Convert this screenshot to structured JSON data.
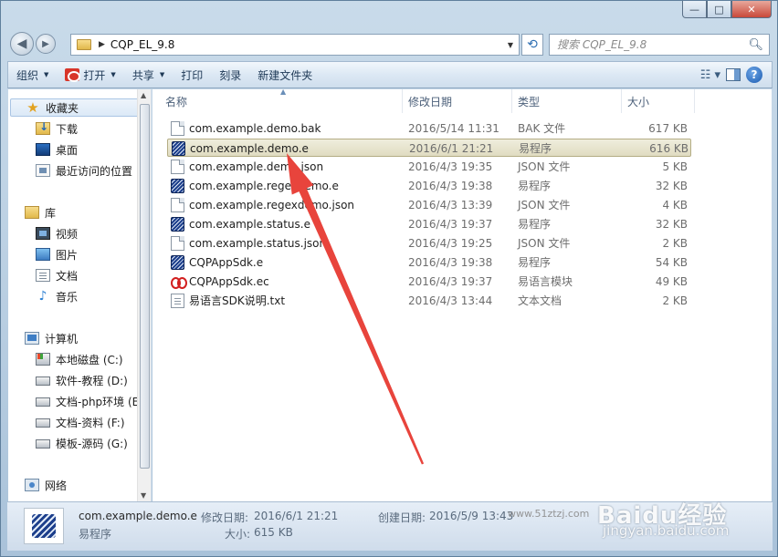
{
  "window": {
    "caption_buttons": {
      "minimize": "—",
      "maximize": "□",
      "close": "✕"
    }
  },
  "address_bar": {
    "path": "CQP_EL_9.8",
    "search_placeholder": "搜索 CQP_EL_9.8"
  },
  "toolbar": {
    "organize": "组织",
    "open": "打开",
    "share": "共享",
    "print": "打印",
    "burn": "刻录",
    "new_folder": "新建文件夹"
  },
  "nav_pane": {
    "favorites": "收藏夹",
    "downloads": "下载",
    "desktop": "桌面",
    "recent": "最近访问的位置",
    "libraries": "库",
    "videos": "视频",
    "pictures": "图片",
    "documents": "文档",
    "music": "音乐",
    "computer": "计算机",
    "drives": [
      "本地磁盘 (C:)",
      "软件-教程 (D:)",
      "文档-php环境 (E",
      "文档-资料 (F:)",
      "模板-源码 (G:)"
    ],
    "network": "网络"
  },
  "columns": {
    "name": "名称",
    "date": "修改日期",
    "type": "类型",
    "size": "大小"
  },
  "files": [
    {
      "name": "com.example.demo.bak",
      "date": "2016/5/14 11:31",
      "type": "BAK 文件",
      "size": "617 KB",
      "icon": "generic-file-icon"
    },
    {
      "name": "com.example.demo.e",
      "date": "2016/6/1 21:21",
      "type": "易程序",
      "size": "616 KB",
      "icon": "e-program-icon"
    },
    {
      "name": "com.example.demo.json",
      "date": "2016/4/3 19:35",
      "type": "JSON 文件",
      "size": "5 KB",
      "icon": "generic-file-icon"
    },
    {
      "name": "com.example.regexdemo.e",
      "date": "2016/4/3 19:38",
      "type": "易程序",
      "size": "32 KB",
      "icon": "e-program-icon"
    },
    {
      "name": "com.example.regexdemo.json",
      "date": "2016/4/3 13:39",
      "type": "JSON 文件",
      "size": "4 KB",
      "icon": "generic-file-icon"
    },
    {
      "name": "com.example.status.e",
      "date": "2016/4/3 19:37",
      "type": "易程序",
      "size": "32 KB",
      "icon": "e-program-icon"
    },
    {
      "name": "com.example.status.json",
      "date": "2016/4/3 19:25",
      "type": "JSON 文件",
      "size": "2 KB",
      "icon": "generic-file-icon"
    },
    {
      "name": "CQPAppSdk.e",
      "date": "2016/4/3 19:38",
      "type": "易程序",
      "size": "54 KB",
      "icon": "e-program-icon"
    },
    {
      "name": "CQPAppSdk.ec",
      "date": "2016/4/3 19:37",
      "type": "易语言模块",
      "size": "49 KB",
      "icon": "e-module-icon"
    },
    {
      "name": "易语言SDK说明.txt",
      "date": "2016/4/3 13:44",
      "type": "文本文档",
      "size": "2 KB",
      "icon": "text-file-icon"
    }
  ],
  "selected_index": 1,
  "status": {
    "name": "com.example.demo.e",
    "modified_label": "修改日期:",
    "modified": "2016/6/1 21:21",
    "created_label": "创建日期:",
    "created": "2016/5/9 13:43",
    "type": "易程序",
    "size_label": "大小:",
    "size": "615 KB"
  },
  "watermark": {
    "site": "www.51ztzj.com",
    "brand": "Baidu经验",
    "url": "jingyan.baidu.com"
  },
  "colors": {
    "annotation_arrow": "#e8443c",
    "selection": "#e0dcc1"
  }
}
